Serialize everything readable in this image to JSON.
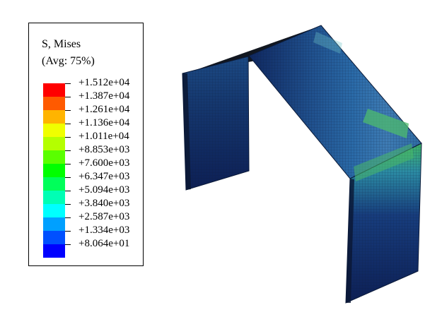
{
  "legend": {
    "title": "S, Mises",
    "subtitle": "(Avg: 75%)",
    "labels": [
      "+1.512e+04",
      "+1.387e+04",
      "+1.261e+04",
      "+1.136e+04",
      "+1.011e+04",
      "+8.853e+03",
      "+7.600e+03",
      "+6.347e+03",
      "+5.094e+03",
      "+3.840e+03",
      "+2.587e+03",
      "+1.334e+03",
      "+8.064e+01"
    ],
    "colors": [
      "#ff0000",
      "#ff5a00",
      "#ffb400",
      "#f0ff00",
      "#b4ff00",
      "#5aff00",
      "#00ff00",
      "#00ff5a",
      "#00ffb4",
      "#00ffff",
      "#00a0ff",
      "#0050ff",
      "#0000ff"
    ]
  },
  "model": {
    "name": "fea-frame-model",
    "colors": {
      "dark": "#0d1f55",
      "mid": "#1f4f8c",
      "light": "#3e7cb4",
      "hot": "#3fb565"
    }
  }
}
